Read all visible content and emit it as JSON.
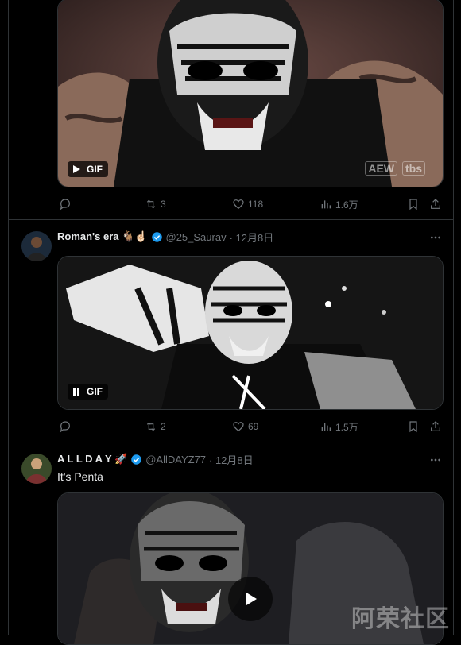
{
  "tweets": [
    {
      "media": {
        "badge": "GIF",
        "network_logos": [
          "AEW",
          "tbs"
        ]
      },
      "actions": {
        "retweets": "3",
        "likes": "118",
        "views": "1.6万"
      }
    },
    {
      "user": {
        "name": "Roman's era 🐐☝🏻",
        "handle": "@25_Saurav",
        "date": "· 12月8日"
      },
      "media": {
        "badge": "GIF"
      },
      "actions": {
        "retweets": "2",
        "likes": "69",
        "views": "1.5万"
      }
    },
    {
      "user": {
        "name": "A L L D A Y 🚀",
        "handle": "@AllDAYZ77",
        "date": "· 12月8日"
      },
      "text": "It's Penta"
    }
  ],
  "watermark": "阿荣社区",
  "colors": {
    "verified": "#1d9bf0",
    "muted": "#71767b",
    "text": "#e7e9ea",
    "border": "#2f3336"
  }
}
